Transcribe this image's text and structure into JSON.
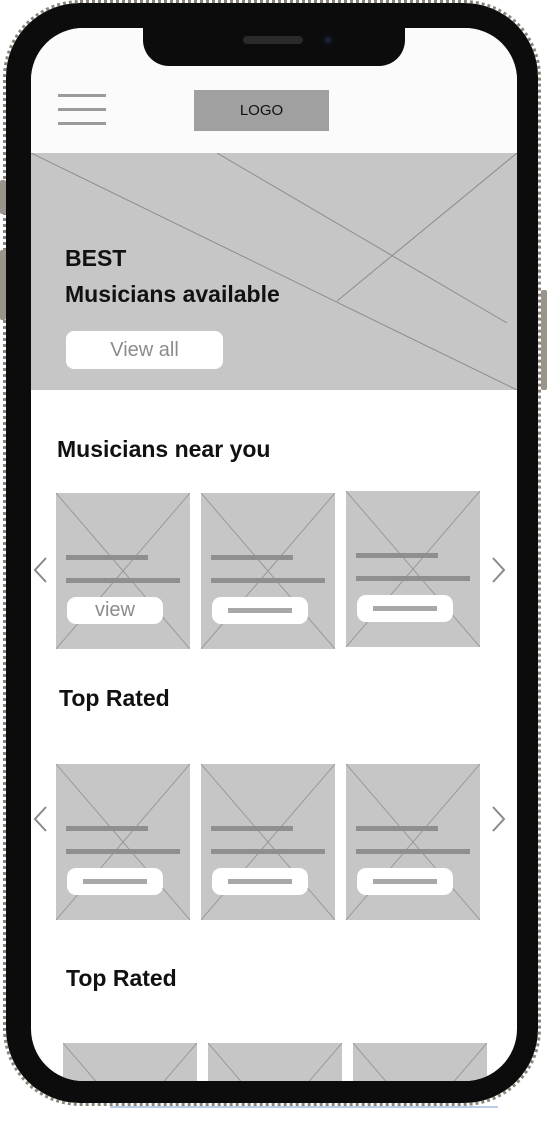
{
  "header": {
    "menu_icon": "hamburger-icon",
    "logo_text": "LOGO"
  },
  "hero": {
    "title_line1": "BEST",
    "title_line2": "Musicians available",
    "button_label": "View all",
    "image_icon": "image-placeholder-icon"
  },
  "sections": [
    {
      "title": "Musicians near you",
      "cards": [
        {
          "button_label": "view"
        },
        {
          "button_label": ""
        },
        {
          "button_label": ""
        }
      ]
    },
    {
      "title": "Top Rated",
      "cards": [
        {
          "button_label": ""
        },
        {
          "button_label": ""
        },
        {
          "button_label": ""
        }
      ]
    },
    {
      "title": "Top Rated",
      "cards": [
        {},
        {},
        {}
      ]
    }
  ],
  "colors": {
    "placeholder": "#c6c6c6",
    "frame": "#0c0c0c",
    "text": "#111111"
  }
}
